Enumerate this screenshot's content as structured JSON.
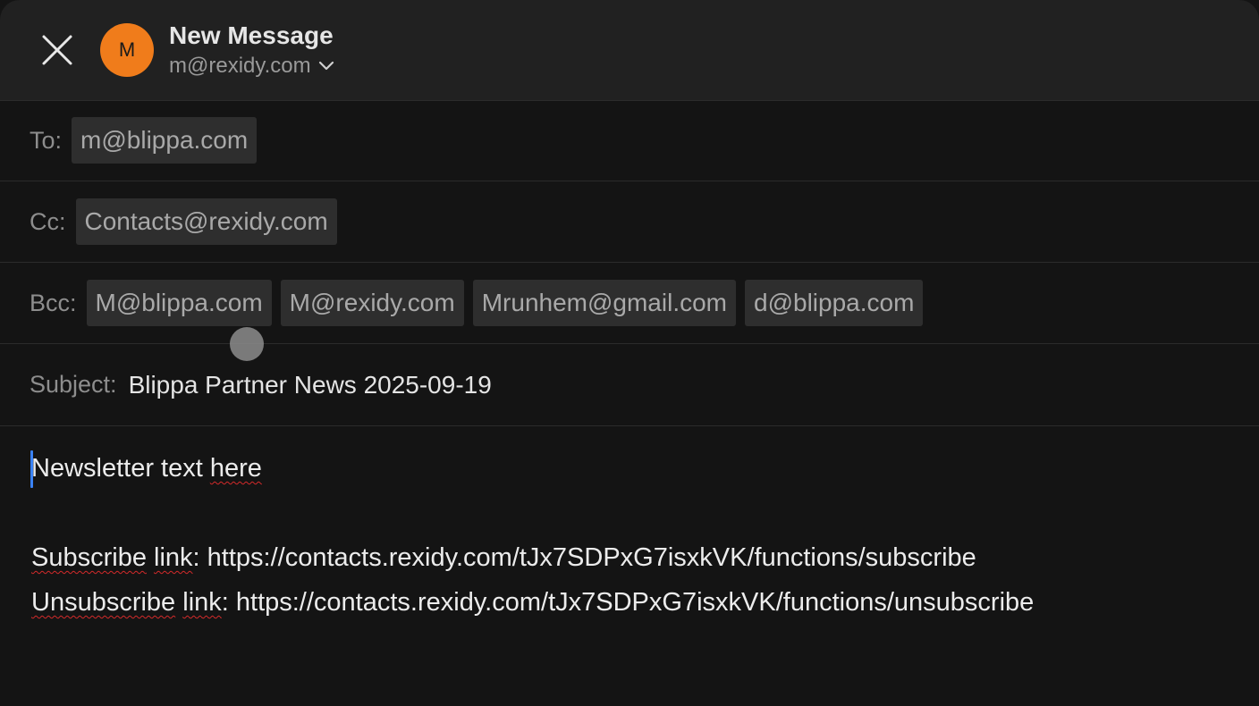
{
  "header": {
    "title": "New Message",
    "avatar_letter": "M",
    "account_email": "m@rexidy.com",
    "close_icon": "close-icon",
    "chevron_icon": "chevron-down-icon",
    "avatar_color": "#f07c1b"
  },
  "fields": {
    "to": {
      "label": "To:",
      "recipients": [
        "m@blippa.com"
      ]
    },
    "cc": {
      "label": "Cc:",
      "recipients": [
        "Contacts@rexidy.com"
      ]
    },
    "bcc": {
      "label": "Bcc:",
      "recipients": [
        "M@blippa.com",
        "M@rexidy.com",
        "Mrunhem@gmail.com",
        "d@blippa.com"
      ]
    },
    "subject": {
      "label": "Subject:",
      "value": "Blippa Partner News 2025-09-19"
    }
  },
  "body": {
    "line1": {
      "prefix": "Newsletter text ",
      "misspelled": "here"
    },
    "subscribe": {
      "misspelled_1": "Subscribe",
      "space": " ",
      "misspelled_2": "link",
      "rest": ": https://contacts.rexidy.com/tJx7SDPxG7isxkVK/functions/subscribe"
    },
    "unsubscribe": {
      "misspelled_1": "Unsubscribe",
      "space": " ",
      "misspelled_2": "link",
      "rest": ": https://contacts.rexidy.com/tJx7SDPxG7isxkVK/functions/unsubscribe"
    }
  },
  "colors": {
    "background": "#141414",
    "header_background": "#212121",
    "chip_background": "#2e2e2e",
    "caret": "#3a82f6",
    "spellcheck_underline": "#d42a2a"
  }
}
